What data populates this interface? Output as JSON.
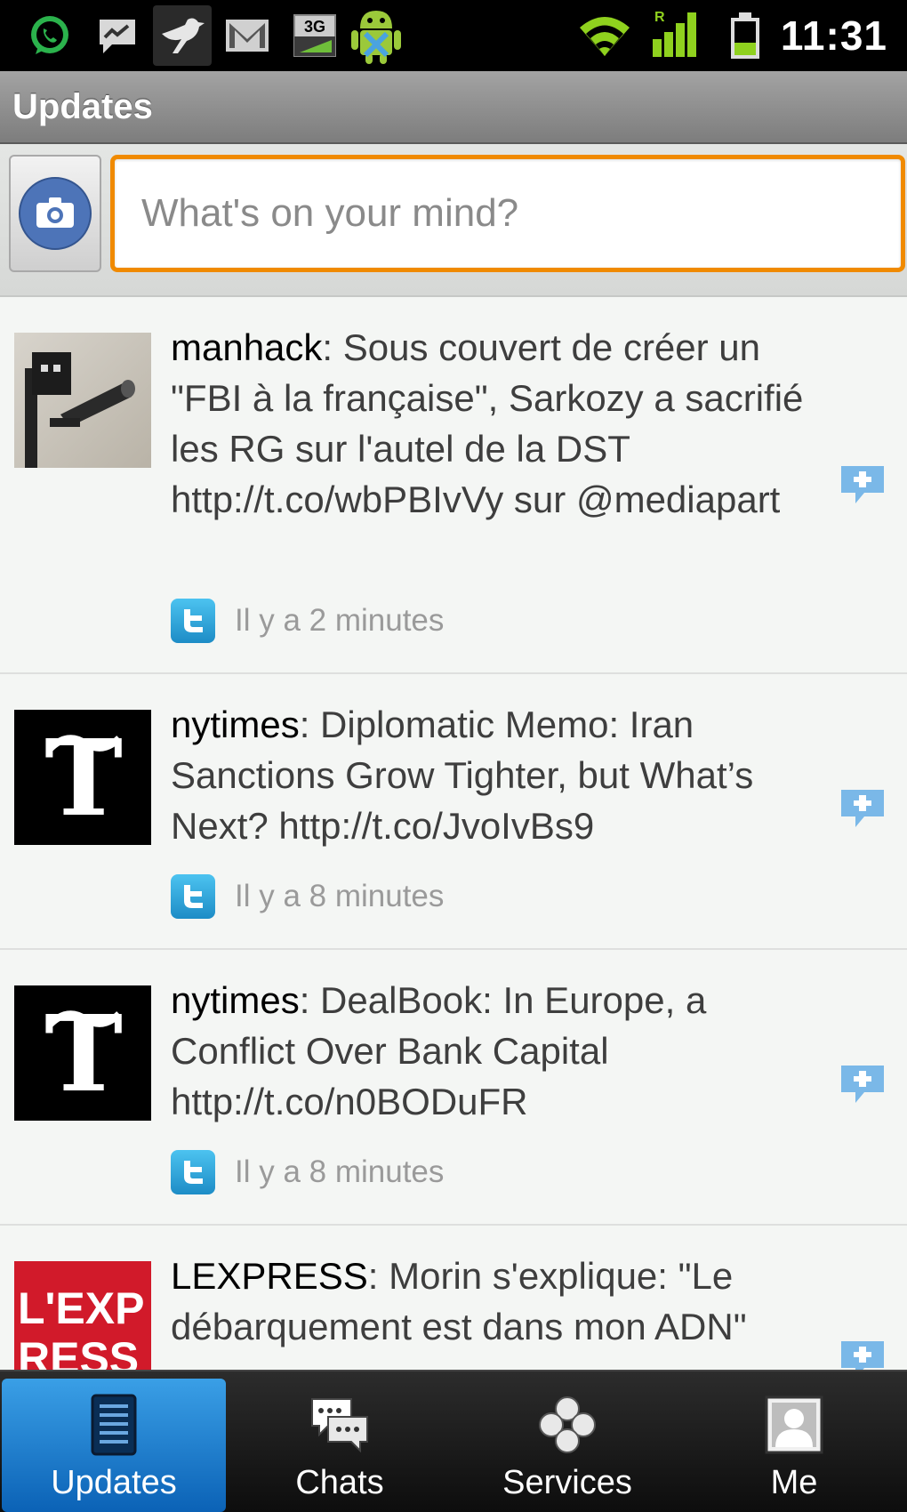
{
  "status_bar": {
    "time": "11:31",
    "network_badge": "3G",
    "roaming_badge": "R",
    "notification_icons": [
      "whatsapp-icon",
      "messenger-icon",
      "twitter-bird-icon",
      "gmail-icon",
      "3g-data-icon",
      "android-debug-icon"
    ],
    "system_icons": [
      "wifi-icon",
      "signal-icon",
      "battery-icon"
    ]
  },
  "title_bar": {
    "title": "Updates"
  },
  "composer": {
    "camera_icon": "camera-icon",
    "placeholder": "What's on your mind?"
  },
  "feed": {
    "items": [
      {
        "author": "manhack",
        "text": ": Sous couvert de créer un \"FBI à la française\", Sarkozy a sacrifié les RG sur l'autel de la DST http://t.co/wbPBIvVy sur @mediapart",
        "time": "Il y a 2 minutes",
        "avatar": "surveillance-camera-avatar",
        "source_icon": "twitter-icon"
      },
      {
        "author": "nytimes",
        "text": ": Diplomatic Memo: Iran Sanctions Grow Tighter, but What’s Next? http://t.co/JvoIvBs9",
        "time": "Il y a 8 minutes",
        "avatar": "nytimes-logo-avatar",
        "source_icon": "twitter-icon"
      },
      {
        "author": "nytimes",
        "text": ": DealBook: In Europe, a Conflict Over Bank Capital http://t.co/n0BODuFR",
        "time": "Il y a 8 minutes",
        "avatar": "nytimes-logo-avatar",
        "source_icon": "twitter-icon"
      },
      {
        "author": "LEXPRESS",
        "text": ": Morin s'explique: \"Le débarquement est dans mon ADN\"",
        "avatar": "lexpress-logo-avatar",
        "avatar_text_line1": "L'EXP",
        "avatar_text_line2": "RESS",
        "source_icon": "twitter-icon"
      }
    ]
  },
  "tab_bar": {
    "tabs": [
      {
        "label": "Updates",
        "icon": "updates-icon",
        "active": true
      },
      {
        "label": "Chats",
        "icon": "chats-icon",
        "active": false
      },
      {
        "label": "Services",
        "icon": "services-icon",
        "active": false
      },
      {
        "label": "Me",
        "icon": "me-icon",
        "active": false
      }
    ]
  },
  "colors": {
    "accent_orange": "#f08a00",
    "tab_active_blue": "#1b7fd4",
    "twitter_blue": "#2fa7e0",
    "lexpress_red": "#d11a2a"
  }
}
